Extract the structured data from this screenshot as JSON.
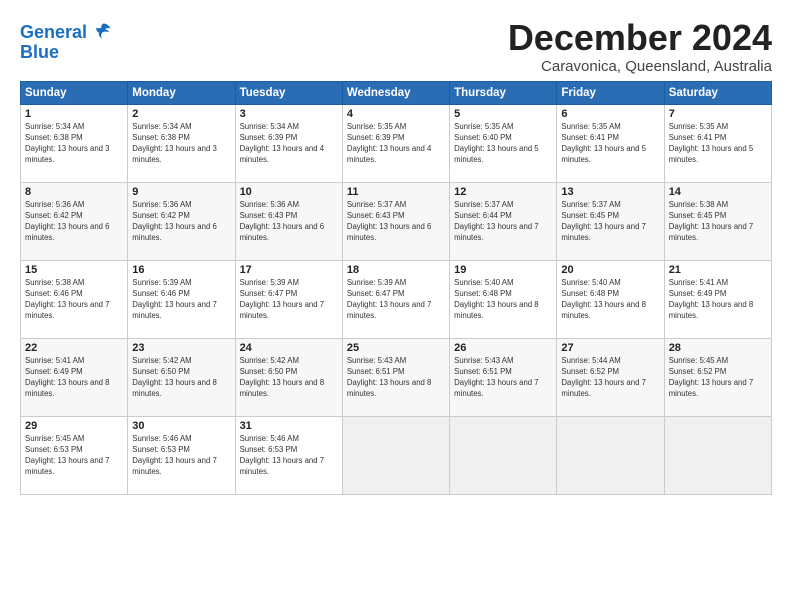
{
  "logo": {
    "line1": "General",
    "line2": "Blue"
  },
  "title": "December 2024",
  "location": "Caravonica, Queensland, Australia",
  "days_of_week": [
    "Sunday",
    "Monday",
    "Tuesday",
    "Wednesday",
    "Thursday",
    "Friday",
    "Saturday"
  ],
  "weeks": [
    [
      {
        "day": "1",
        "rise": "5:34 AM",
        "set": "6:38 PM",
        "daylight": "13 hours and 3 minutes."
      },
      {
        "day": "2",
        "rise": "5:34 AM",
        "set": "6:38 PM",
        "daylight": "13 hours and 3 minutes."
      },
      {
        "day": "3",
        "rise": "5:34 AM",
        "set": "6:39 PM",
        "daylight": "13 hours and 4 minutes."
      },
      {
        "day": "4",
        "rise": "5:35 AM",
        "set": "6:39 PM",
        "daylight": "13 hours and 4 minutes."
      },
      {
        "day": "5",
        "rise": "5:35 AM",
        "set": "6:40 PM",
        "daylight": "13 hours and 5 minutes."
      },
      {
        "day": "6",
        "rise": "5:35 AM",
        "set": "6:41 PM",
        "daylight": "13 hours and 5 minutes."
      },
      {
        "day": "7",
        "rise": "5:35 AM",
        "set": "6:41 PM",
        "daylight": "13 hours and 5 minutes."
      }
    ],
    [
      {
        "day": "8",
        "rise": "5:36 AM",
        "set": "6:42 PM",
        "daylight": "13 hours and 6 minutes."
      },
      {
        "day": "9",
        "rise": "5:36 AM",
        "set": "6:42 PM",
        "daylight": "13 hours and 6 minutes."
      },
      {
        "day": "10",
        "rise": "5:36 AM",
        "set": "6:43 PM",
        "daylight": "13 hours and 6 minutes."
      },
      {
        "day": "11",
        "rise": "5:37 AM",
        "set": "6:43 PM",
        "daylight": "13 hours and 6 minutes."
      },
      {
        "day": "12",
        "rise": "5:37 AM",
        "set": "6:44 PM",
        "daylight": "13 hours and 7 minutes."
      },
      {
        "day": "13",
        "rise": "5:37 AM",
        "set": "6:45 PM",
        "daylight": "13 hours and 7 minutes."
      },
      {
        "day": "14",
        "rise": "5:38 AM",
        "set": "6:45 PM",
        "daylight": "13 hours and 7 minutes."
      }
    ],
    [
      {
        "day": "15",
        "rise": "5:38 AM",
        "set": "6:46 PM",
        "daylight": "13 hours and 7 minutes."
      },
      {
        "day": "16",
        "rise": "5:39 AM",
        "set": "6:46 PM",
        "daylight": "13 hours and 7 minutes."
      },
      {
        "day": "17",
        "rise": "5:39 AM",
        "set": "6:47 PM",
        "daylight": "13 hours and 7 minutes."
      },
      {
        "day": "18",
        "rise": "5:39 AM",
        "set": "6:47 PM",
        "daylight": "13 hours and 7 minutes."
      },
      {
        "day": "19",
        "rise": "5:40 AM",
        "set": "6:48 PM",
        "daylight": "13 hours and 8 minutes."
      },
      {
        "day": "20",
        "rise": "5:40 AM",
        "set": "6:48 PM",
        "daylight": "13 hours and 8 minutes."
      },
      {
        "day": "21",
        "rise": "5:41 AM",
        "set": "6:49 PM",
        "daylight": "13 hours and 8 minutes."
      }
    ],
    [
      {
        "day": "22",
        "rise": "5:41 AM",
        "set": "6:49 PM",
        "daylight": "13 hours and 8 minutes."
      },
      {
        "day": "23",
        "rise": "5:42 AM",
        "set": "6:50 PM",
        "daylight": "13 hours and 8 minutes."
      },
      {
        "day": "24",
        "rise": "5:42 AM",
        "set": "6:50 PM",
        "daylight": "13 hours and 8 minutes."
      },
      {
        "day": "25",
        "rise": "5:43 AM",
        "set": "6:51 PM",
        "daylight": "13 hours and 8 minutes."
      },
      {
        "day": "26",
        "rise": "5:43 AM",
        "set": "6:51 PM",
        "daylight": "13 hours and 7 minutes."
      },
      {
        "day": "27",
        "rise": "5:44 AM",
        "set": "6:52 PM",
        "daylight": "13 hours and 7 minutes."
      },
      {
        "day": "28",
        "rise": "5:45 AM",
        "set": "6:52 PM",
        "daylight": "13 hours and 7 minutes."
      }
    ],
    [
      {
        "day": "29",
        "rise": "5:45 AM",
        "set": "6:53 PM",
        "daylight": "13 hours and 7 minutes."
      },
      {
        "day": "30",
        "rise": "5:46 AM",
        "set": "6:53 PM",
        "daylight": "13 hours and 7 minutes."
      },
      {
        "day": "31",
        "rise": "5:46 AM",
        "set": "6:53 PM",
        "daylight": "13 hours and 7 minutes."
      },
      null,
      null,
      null,
      null
    ]
  ]
}
